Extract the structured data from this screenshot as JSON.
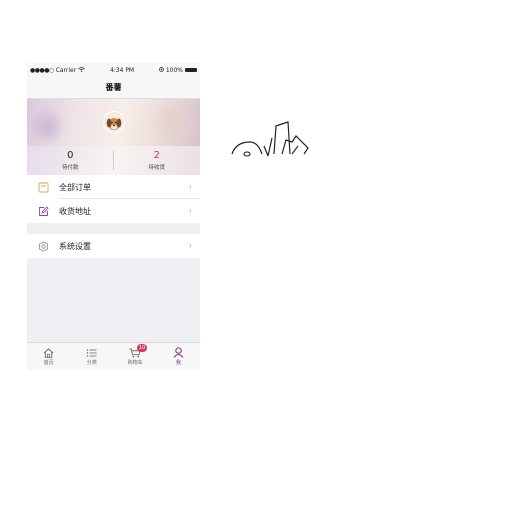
{
  "status_bar": {
    "carrier": "Carrier",
    "wifi_icon": "wifi-icon",
    "time": "4:34 PM",
    "battery": "100%"
  },
  "nav": {
    "title": "番薯"
  },
  "profile": {
    "avatar_icon": "dog-avatar",
    "stats": [
      {
        "value": "0",
        "label": "待付款",
        "color": "#222222"
      },
      {
        "value": "2",
        "label": "待收货",
        "color": "#d23a5e"
      }
    ]
  },
  "menu": {
    "items": [
      {
        "label": "全部订单",
        "icon": "bag-icon",
        "icon_color": "#d7a94a"
      },
      {
        "label": "收货地址",
        "icon": "edit-icon",
        "icon_color": "#8a4bb0"
      }
    ],
    "settings": {
      "label": "系统设置",
      "icon": "gear-icon",
      "icon_color": "#888888"
    }
  },
  "tabbar": {
    "tabs": [
      {
        "label": "首页",
        "icon": "home-icon"
      },
      {
        "label": "分类",
        "icon": "list-icon"
      },
      {
        "label": "购物车",
        "icon": "cart-icon",
        "badge": "10"
      },
      {
        "label": "我",
        "icon": "person-icon",
        "active": true
      }
    ],
    "accent": "#8a2b7a"
  }
}
